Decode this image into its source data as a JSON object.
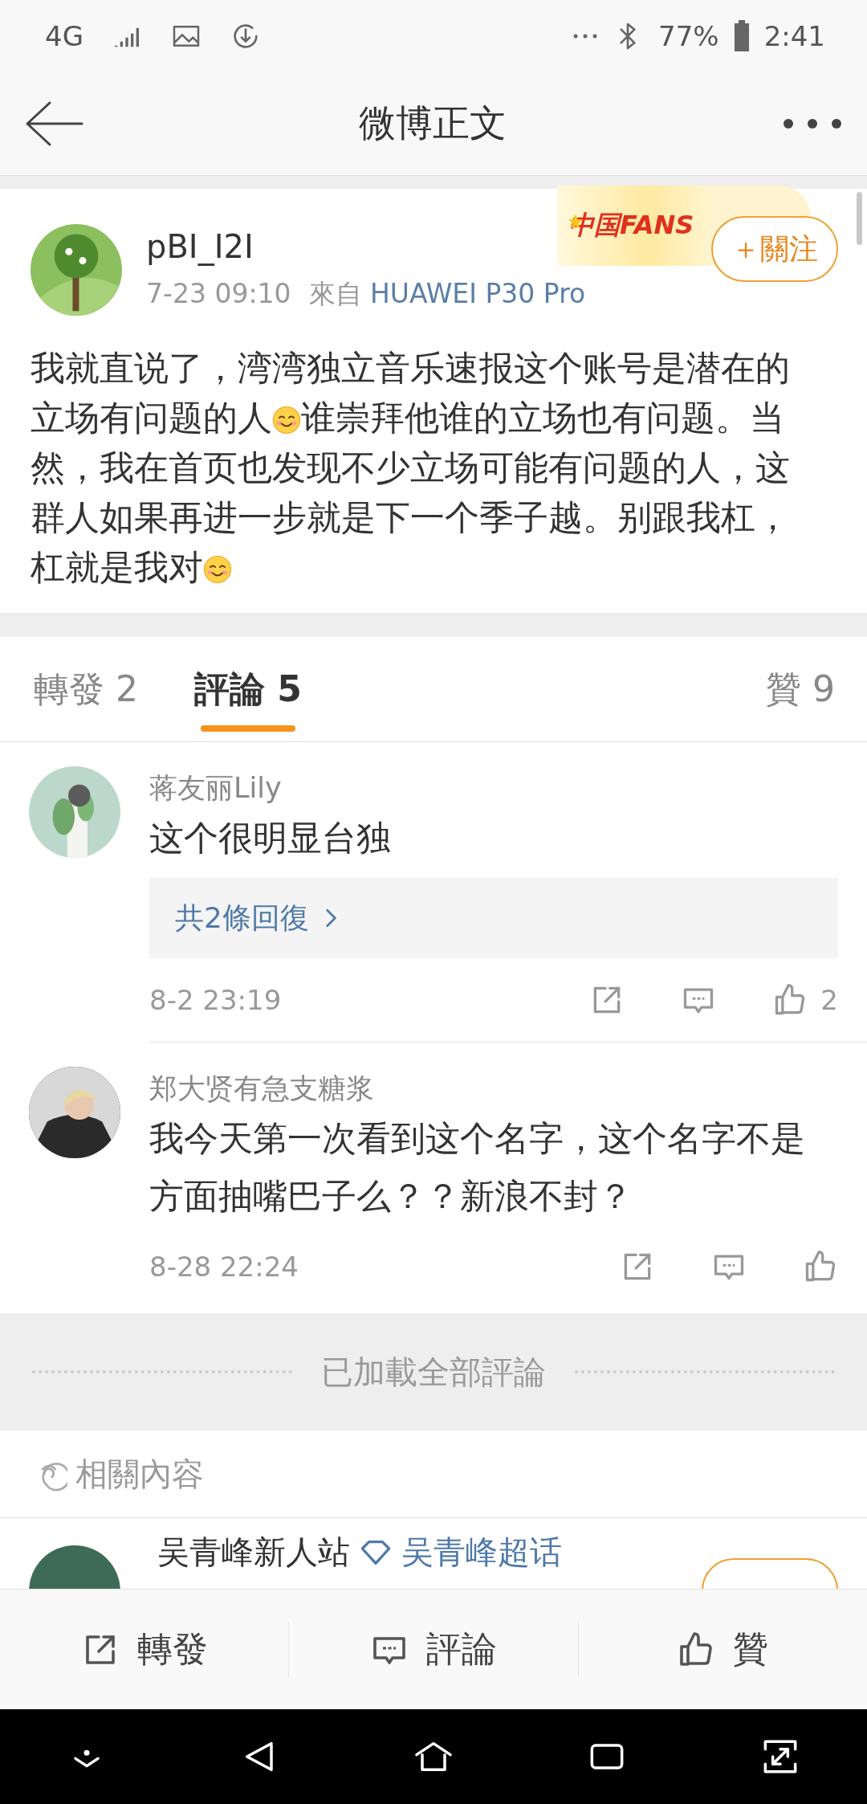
{
  "status_bar": {
    "network": "4G",
    "battery": "77%",
    "time": "2:41"
  },
  "nav": {
    "title": "微博正文"
  },
  "post": {
    "username": "pBI_I2I",
    "time": "7-23 09:10",
    "source_prefix": "來自",
    "source": "HUAWEI P30 Pro",
    "badge": "中国FANS",
    "follow": "＋關注",
    "text": [
      {
        "kind": "text",
        "text": "我就直说了，湾湾独立音乐速报这个账号是潜在的立场有问题的人"
      },
      {
        "kind": "emoji"
      },
      {
        "kind": "text",
        "text": "谁崇拜他谁的立场也有问题。当然，我在首页也发现不少立场可能有问题的人，这群人如果再进一步就是下一个季子越。别跟我杠，杠就是我对"
      },
      {
        "kind": "emoji"
      }
    ]
  },
  "tabs": [
    {
      "label": "轉發",
      "count": "2",
      "selected": false
    },
    {
      "label": "評論",
      "count": "5",
      "selected": true
    },
    {
      "label": "贊",
      "count": "9",
      "selected": false
    }
  ],
  "comments": [
    {
      "name": "蒋友丽Lily",
      "text": "这个很明显台独",
      "replies": "共2條回復",
      "time": "8-2 23:19",
      "likes": "2"
    },
    {
      "name": "郑大贤有急支糖浆",
      "text": "我今天第一次看到这个名字，这个名字不是方面抽嘴巴子么？？新浪不封？",
      "time": "8-28 22:24"
    }
  ],
  "end_notice": "已加載全部評論",
  "related": {
    "title": "相關內容",
    "item": {
      "name": "吴青峰新人站",
      "topic": "吴青峰超话"
    }
  },
  "actions": [
    {
      "kind": "repost",
      "label": "轉發"
    },
    {
      "kind": "comment",
      "label": "評論"
    },
    {
      "kind": "like",
      "label": "贊"
    }
  ]
}
